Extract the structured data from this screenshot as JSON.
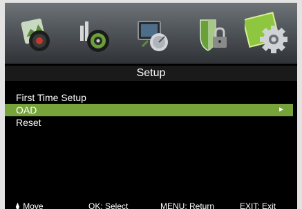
{
  "icons": [
    {
      "name": "picture-menu-icon",
      "selected": false
    },
    {
      "name": "sound-menu-icon",
      "selected": false
    },
    {
      "name": "channel-menu-icon",
      "selected": false
    },
    {
      "name": "lock-menu-icon",
      "selected": false
    },
    {
      "name": "setup-menu-icon",
      "selected": true
    }
  ],
  "title": "Setup",
  "menu": {
    "items": [
      {
        "label": "First Time Setup"
      },
      {
        "label": "OAD",
        "arrow": "►"
      },
      {
        "label": "Reset"
      }
    ]
  },
  "hints": {
    "move_icon": "up-down-arrows",
    "move": "Move",
    "select": "OK: Select",
    "return": "MENU: Return",
    "exit": "EXIT: Exit"
  },
  "colors": {
    "highlight": "#76a43a",
    "title_bar": "#1a1a1a",
    "background": "#000000"
  }
}
